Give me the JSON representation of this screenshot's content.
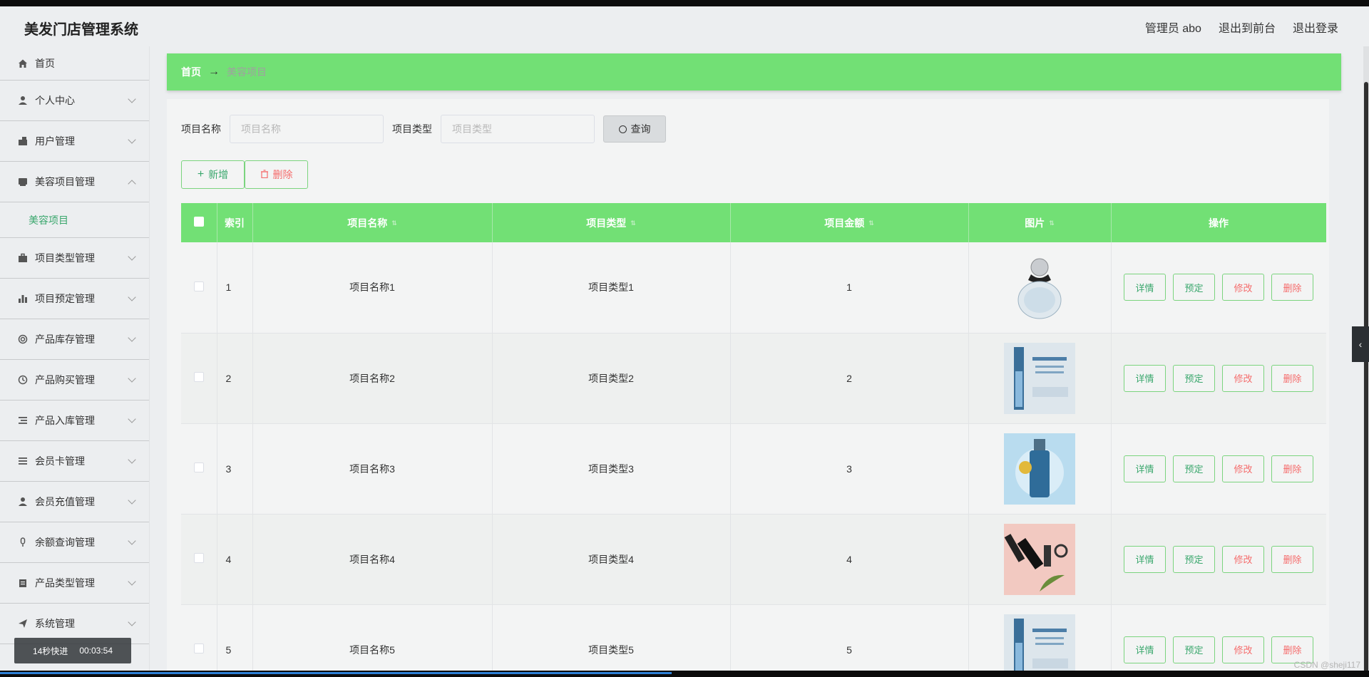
{
  "app": {
    "title": "美发门店管理系统"
  },
  "header": {
    "admin": "管理员 abo",
    "front": "退出到前台",
    "logout": "退出登录"
  },
  "sidebar": {
    "items": [
      {
        "label": "首页",
        "icon": "home-icon"
      },
      {
        "label": "个人中心",
        "icon": "user-icon"
      },
      {
        "label": "用户管理",
        "icon": "users-icon"
      },
      {
        "label": "美容项目管理",
        "icon": "folder-icon",
        "expanded": true
      },
      {
        "label": "项目类型管理",
        "icon": "briefcase-icon"
      },
      {
        "label": "项目预定管理",
        "icon": "bar-chart-icon"
      },
      {
        "label": "产品库存管理",
        "icon": "lifebuoy-icon"
      },
      {
        "label": "产品购买管理",
        "icon": "clock-icon"
      },
      {
        "label": "产品入库管理",
        "icon": "list-icon"
      },
      {
        "label": "会员卡管理",
        "icon": "menu-icon"
      },
      {
        "label": "会员充值管理",
        "icon": "user-icon"
      },
      {
        "label": "余额查询管理",
        "icon": "mic-icon"
      },
      {
        "label": "产品类型管理",
        "icon": "clipboard-icon"
      },
      {
        "label": "系统管理",
        "icon": "send-icon"
      }
    ],
    "subitem": "美容项目"
  },
  "breadcrumb": {
    "home": "首页",
    "sep": "→",
    "current": "美容项目"
  },
  "search": {
    "name_label": "项目名称",
    "name_placeholder": "项目名称",
    "type_label": "项目类型",
    "type_placeholder": "项目类型",
    "query": "查询"
  },
  "actions": {
    "add": "新增",
    "delete": "删除"
  },
  "table": {
    "headers": [
      "索引",
      "项目名称",
      "项目类型",
      "项目金额",
      "图片",
      "操作"
    ],
    "rows": [
      {
        "idx": "1",
        "name": "项目名称1",
        "type": "项目类型1",
        "amount": "1",
        "image": "perfume-bottle-image"
      },
      {
        "idx": "2",
        "name": "项目名称2",
        "type": "项目类型2",
        "amount": "2",
        "image": "serum-ad-image"
      },
      {
        "idx": "3",
        "name": "项目名称3",
        "type": "项目类型3",
        "amount": "3",
        "image": "splash-bottle-image"
      },
      {
        "idx": "4",
        "name": "项目名称4",
        "type": "项目类型4",
        "amount": "4",
        "image": "makeup-tools-image"
      },
      {
        "idx": "5",
        "name": "项目名称5",
        "type": "项目类型5",
        "amount": "5",
        "image": "serum-ad-image"
      }
    ],
    "ops": {
      "detail": "详情",
      "book": "预定",
      "edit": "修改",
      "delete": "删除"
    }
  },
  "overlay": {
    "speed": "14秒快进",
    "time": "00:03:54"
  },
  "watermark": "CSDN @sheji117",
  "colors": {
    "accent": "#72e075",
    "green_text": "#3aa76d",
    "red_text": "#f56c6c"
  }
}
